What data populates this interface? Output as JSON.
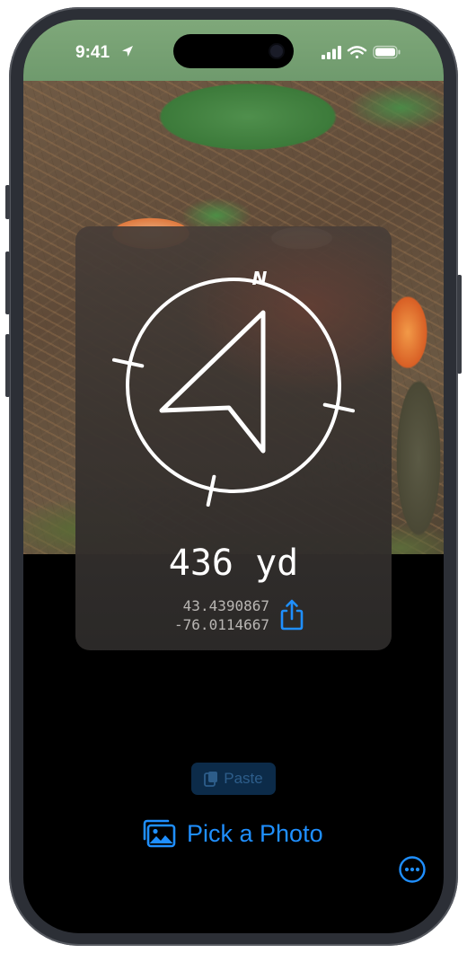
{
  "status_bar": {
    "time": "9:41",
    "location_icon": "location-arrow-icon",
    "icons": [
      "cellular-signal-icon",
      "wifi-icon",
      "battery-icon"
    ]
  },
  "photo": {
    "subject": "forest floor with ferns and orange bracket mushrooms"
  },
  "compass": {
    "north_label": "N",
    "arrow_icon": "navigation-arrow-icon",
    "distance": "436 yd",
    "latitude": "43.4390867",
    "longitude": "-76.0114667",
    "share_icon": "share-icon"
  },
  "actions": {
    "paste_label": "Paste",
    "paste_icon": "clipboard-icon",
    "pick_photo_label": "Pick a Photo",
    "pick_photo_icon": "photos-icon",
    "more_icon": "ellipsis-circle-icon"
  },
  "colors": {
    "accent": "#1f8fff",
    "card_background": "#3b3531",
    "screen_background": "#000000"
  }
}
